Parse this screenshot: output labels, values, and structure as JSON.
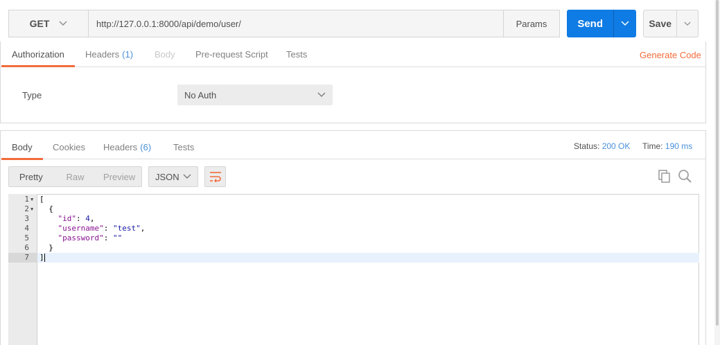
{
  "request": {
    "method": "GET",
    "url": "http://127.0.0.1:8000/api/demo/user/",
    "params_label": "Params",
    "send_label": "Send",
    "save_label": "Save"
  },
  "request_tabs": {
    "authorization": "Authorization",
    "headers": "Headers",
    "headers_count": "(1)",
    "body": "Body",
    "prerequest": "Pre-request Script",
    "tests": "Tests",
    "generate_code": "Generate Code"
  },
  "auth": {
    "type_label": "Type",
    "type_value": "No Auth"
  },
  "response_tabs": {
    "body": "Body",
    "cookies": "Cookies",
    "headers": "Headers",
    "headers_count": "(6)",
    "tests": "Tests"
  },
  "response_meta": {
    "status_label": "Status:",
    "status_value": "200 OK",
    "time_label": "Time:",
    "time_value": "190 ms"
  },
  "view": {
    "pretty": "Pretty",
    "raw": "Raw",
    "preview": "Preview",
    "format": "JSON"
  },
  "icons": [
    "chevron-down-icon",
    "wrap-lines-icon",
    "copy-icon",
    "search-icon"
  ],
  "colors": {
    "accent": "#f26b3a",
    "send": "#0f7be4",
    "link": "#4a90d9"
  },
  "code_lines": [
    {
      "num": "1",
      "text": "["
    },
    {
      "num": "2",
      "text": "  {"
    },
    {
      "num": "3",
      "text": "    \"id\": 4,"
    },
    {
      "num": "4",
      "text": "    \"username\": \"test\","
    },
    {
      "num": "5",
      "text": "    \"password\": \"\""
    },
    {
      "num": "6",
      "text": "  }"
    },
    {
      "num": "7",
      "text": "]"
    }
  ]
}
